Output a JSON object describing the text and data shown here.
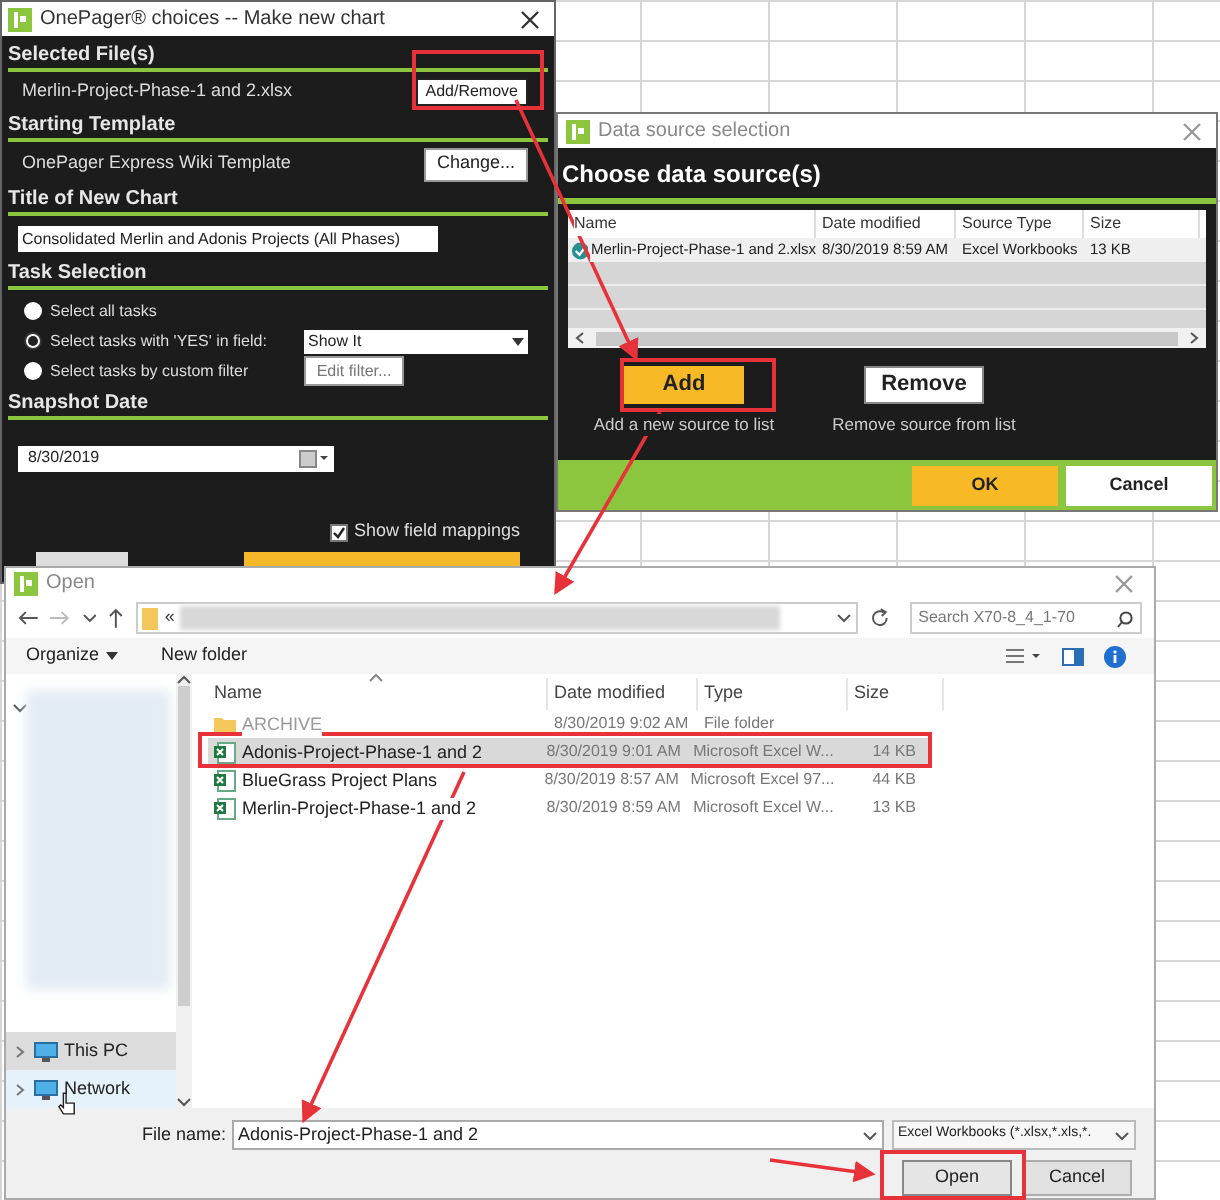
{
  "choices_window": {
    "title": "OnePager® choices -- Make new chart",
    "selected_files": {
      "heading": "Selected File(s)",
      "file": "Merlin-Project-Phase-1 and 2.xlsx",
      "button": "Add/Remove"
    },
    "starting_template": {
      "heading": "Starting Template",
      "template": "OnePager Express Wiki Template",
      "button": "Change..."
    },
    "title_of_new_chart": {
      "heading": "Title of New Chart",
      "value": "Consolidated Merlin and Adonis Projects (All Phases)"
    },
    "task_selection": {
      "heading": "Task Selection",
      "options": [
        {
          "label": "Select all tasks",
          "selected": false,
          "kind": "plain"
        },
        {
          "label": "Select tasks with 'YES' in field:",
          "selected": true,
          "kind": "dropdown",
          "value": "Show It"
        },
        {
          "label": "Select tasks by custom filter",
          "selected": false,
          "kind": "button",
          "button": "Edit filter..."
        }
      ]
    },
    "snapshot_date": {
      "heading": "Snapshot Date",
      "value": "8/30/2019"
    },
    "show_field_mappings": {
      "label": "Show field mappings",
      "checked": true
    }
  },
  "data_source_window": {
    "title": "Data source selection",
    "heading": "Choose data source(s)",
    "columns": [
      "Name",
      "Date modified",
      "Source Type",
      "Size"
    ],
    "rows": [
      {
        "name": "Merlin-Project-Phase-1 and 2.xlsx",
        "date": "8/30/2019 8:59 AM",
        "type": "Excel Workbooks",
        "size": "13 KB"
      }
    ],
    "buttons": [
      {
        "label": "Add",
        "caption": "Add a new source to list",
        "kind": "primary"
      },
      {
        "label": "Remove",
        "caption": "Remove source from list",
        "kind": "secondary"
      }
    ],
    "footer_buttons": [
      {
        "label": "OK",
        "kind": "primary"
      },
      {
        "label": "Cancel",
        "kind": "secondary"
      }
    ]
  },
  "open_dialog": {
    "title": "Open",
    "path_prefix": "«",
    "search": {
      "placeholder": "Search X70-8_4_1-70"
    },
    "toolbar": {
      "organize": "Organize",
      "new_folder": "New folder"
    },
    "nav": [
      {
        "label": "This PC",
        "selected": true
      },
      {
        "label": "Network",
        "selected": false
      }
    ],
    "columns": [
      "Name",
      "Date modified",
      "Type",
      "Size"
    ],
    "files": [
      {
        "name": "ARCHIVE",
        "date": "8/30/2019 9:02 AM",
        "type": "File folder",
        "kind": "folder",
        "selected": false
      },
      {
        "name": "Adonis-Project-Phase-1 and 2",
        "date": "8/30/2019 9:01 AM",
        "type": "Microsoft Excel W...",
        "size": "14 KB",
        "kind": "excel",
        "selected": true
      },
      {
        "name": "BlueGrass Project Plans",
        "date": "8/30/2019 8:57 AM",
        "type": "Microsoft Excel 97...",
        "size": "44 KB",
        "kind": "excel",
        "selected": false
      },
      {
        "name": "Merlin-Project-Phase-1 and 2",
        "date": "8/30/2019 8:59 AM",
        "type": "Microsoft Excel W...",
        "size": "13 KB",
        "kind": "excel",
        "selected": false
      }
    ],
    "file_name": {
      "label": "File name:",
      "value": "Adonis-Project-Phase-1 and 2"
    },
    "file_type": "Excel Workbooks (*.xlsx,*.xls,*.",
    "buttons": [
      {
        "label": "Open",
        "kind": "primary"
      },
      {
        "label": "Cancel",
        "kind": "secondary"
      }
    ]
  }
}
